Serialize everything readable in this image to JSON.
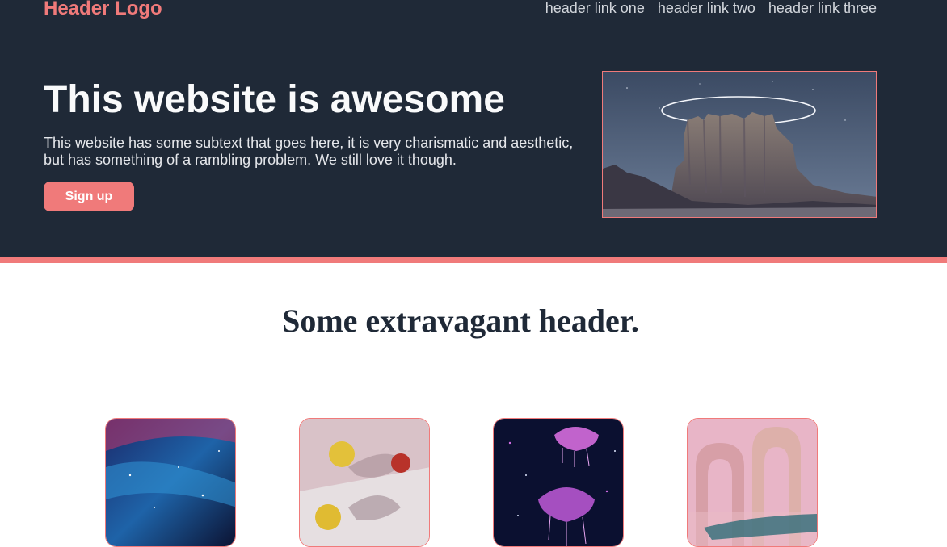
{
  "header": {
    "logo": "Header Logo",
    "links": [
      "header link one",
      "header link two",
      "header link three"
    ]
  },
  "hero": {
    "title": "This website is awesome",
    "subtext": "This website has some subtext that goes here, it is very charismatic and aesthetic, but has something of a rambling problem. We still love it though.",
    "button_label": "Sign up"
  },
  "section": {
    "heading": "Some extravagant header."
  },
  "colors": {
    "accent": "#f07a7a",
    "dark": "#1f2937"
  }
}
